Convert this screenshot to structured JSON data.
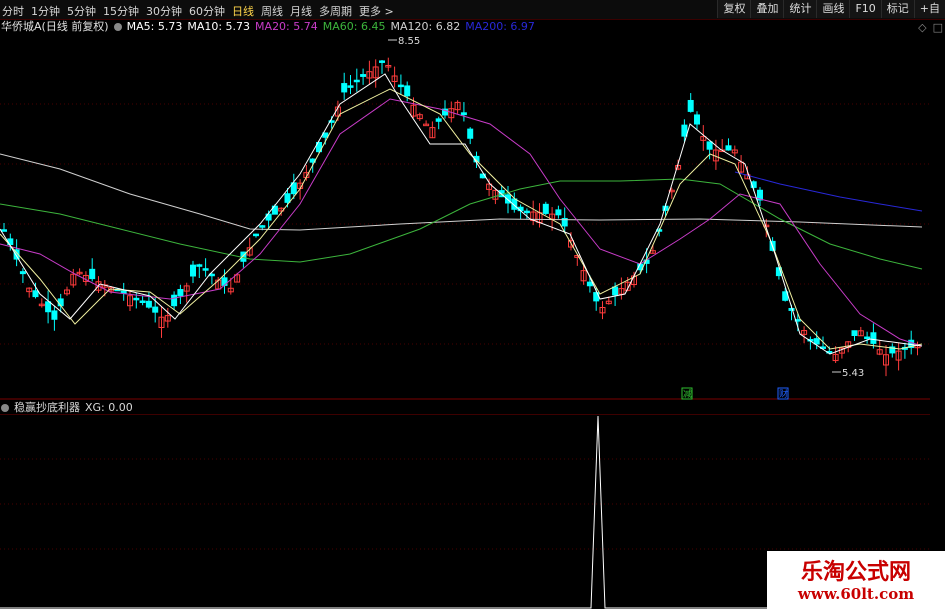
{
  "toolbar": {
    "periods": [
      "分时",
      "1分钟",
      "5分钟",
      "15分钟",
      "30分钟",
      "60分钟",
      "日线",
      "周线",
      "月线",
      "多周期",
      "更多 >"
    ],
    "active_period": "日线",
    "right_buttons": [
      "复权",
      "叠加",
      "统计",
      "画线",
      "F10",
      "标记",
      "+自"
    ]
  },
  "legend": {
    "stock": "华侨城A(日线 前复权)",
    "items": [
      {
        "text": "MA5: 5.73",
        "color": "#ffffff"
      },
      {
        "text": "MA10: 5.73",
        "color": "#ffffff"
      },
      {
        "text": "MA20: 5.74",
        "color": "#c83cc8"
      },
      {
        "text": "MA60: 6.45",
        "color": "#3cb43c"
      },
      {
        "text": "MA120: 6.82",
        "color": "#d0d0d0"
      },
      {
        "text": "MA200: 6.97",
        "color": "#2828d8"
      }
    ]
  },
  "side_icons": [
    "diamond-icon",
    "square-icon"
  ],
  "indicator": {
    "name": "稳赢抄底利器",
    "value_text": "XG: 0.00"
  },
  "watermark": {
    "line1": "乐淘公式网",
    "line2": "www.60lt.com"
  },
  "colors": {
    "up": "#ff3c3c",
    "down": "#00ffff",
    "bg": "#000000"
  },
  "chart_data": {
    "type": "candlestick",
    "annotations": [
      {
        "text": "8.55",
        "kind": "high"
      },
      {
        "text": "5.43",
        "kind": "low"
      }
    ],
    "markers": [
      {
        "text": "减",
        "color": "#30c030"
      },
      {
        "text": "财",
        "color": "#2060ff"
      }
    ],
    "ma_values": {
      "MA5": 5.73,
      "MA10": 5.73,
      "MA20": 5.74,
      "MA60": 6.45,
      "MA120": 6.82,
      "MA200": 6.97
    },
    "indicator_series": {
      "name": "XG",
      "current": 0.0,
      "signal_count": 1
    }
  }
}
